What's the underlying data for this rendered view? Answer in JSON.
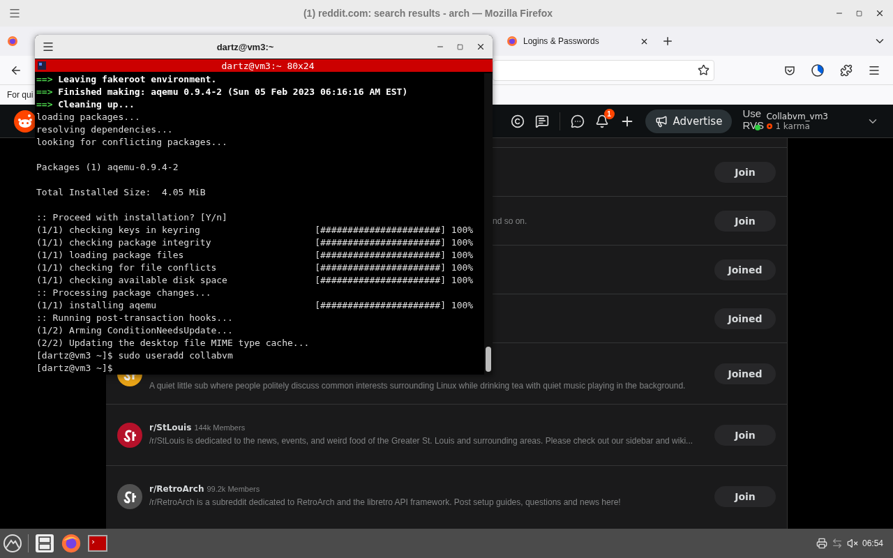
{
  "browser": {
    "title": "(1) reddit.com: search results - arch — Mozilla Firefox",
    "tabs": [
      {
        "label": "Logins & Passwords",
        "selected": false
      }
    ],
    "bookmarks": [
      "For qui"
    ]
  },
  "reddit_header": {
    "notification_count": "1",
    "advertise": "Advertise",
    "avatar_alt": [
      "Use",
      "RVS"
    ],
    "username": "Collabvm_vm3",
    "karma": "1 karma"
  },
  "communities": [
    {
      "kind": "covered",
      "button": "Join"
    },
    {
      "kind": "covered",
      "description": "nd so on.",
      "button": "Join"
    },
    {
      "kind": "covered",
      "button": "Joined"
    },
    {
      "kind": "covered",
      "button": "Joined"
    },
    {
      "kind": "partial",
      "color": "#e8a317",
      "description": "A quiet little sub where people politely discuss common interests surrounding Linux while drinking tea with quiet music playing in the background.",
      "button": "Joined"
    },
    {
      "kind": "full",
      "color": "#b5112a",
      "name": "r/StLouis",
      "members": "144k Members",
      "description": "/r/StLouis is dedicated to the news, events, and weird food of the Greater St. Louis and surrounding areas. Please check out our sidebar and wiki...",
      "button": "Join"
    },
    {
      "kind": "full",
      "color": "#505050",
      "name": "r/RetroArch",
      "members": "99.2k Members",
      "description": "/r/RetroArch is a subreddit dedicated to RetroArch and the libretro API framework. Post setup guides, questions and news here!",
      "button": "Join"
    }
  ],
  "terminal": {
    "title": "dartz@vm3:~",
    "header": "dartz@vm3:~ 80x24",
    "lines": [
      {
        "kind": "arrow",
        "prefix": "==>",
        "text": "Leaving fakeroot environment."
      },
      {
        "kind": "arrow",
        "prefix": "==>",
        "text": "Finished making: aqemu 0.9.4-2 (Sun 05 Feb 2023 06:16:16 AM EST)"
      },
      {
        "kind": "arrow",
        "prefix": "==>",
        "text": "Cleaning up..."
      },
      {
        "kind": "plain",
        "text": "loading packages..."
      },
      {
        "kind": "plain",
        "text": "resolving dependencies..."
      },
      {
        "kind": "plain",
        "text": "looking for conflicting packages..."
      },
      {
        "kind": "blank"
      },
      {
        "kind": "plain",
        "text": "Packages (1) aqemu-0.9.4-2"
      },
      {
        "kind": "blank"
      },
      {
        "kind": "plain",
        "text": "Total Installed Size:  4.05 MiB"
      },
      {
        "kind": "blank"
      },
      {
        "kind": "plain",
        "text": ":: Proceed with installation? [Y/n]"
      },
      {
        "kind": "progress",
        "text": "(1/1) checking keys in keyring",
        "bar": "[######################] 100%"
      },
      {
        "kind": "progress",
        "text": "(1/1) checking package integrity",
        "bar": "[######################] 100%"
      },
      {
        "kind": "progress",
        "text": "(1/1) loading package files",
        "bar": "[######################] 100%"
      },
      {
        "kind": "progress",
        "text": "(1/1) checking for file conflicts",
        "bar": "[######################] 100%"
      },
      {
        "kind": "progress",
        "text": "(1/1) checking available disk space",
        "bar": "[######################] 100%"
      },
      {
        "kind": "plain",
        "text": ":: Processing package changes..."
      },
      {
        "kind": "progress",
        "text": "(1/1) installing aqemu",
        "bar": "[######################] 100%"
      },
      {
        "kind": "plain",
        "text": ":: Running post-transaction hooks..."
      },
      {
        "kind": "plain",
        "text": "(1/2) Arming ConditionNeedsUpdate..."
      },
      {
        "kind": "plain",
        "text": "(2/2) Updating the desktop file MIME type cache..."
      },
      {
        "kind": "plain",
        "text": "[dartz@vm3 ~]$ sudo useradd collabvm"
      },
      {
        "kind": "plain",
        "text": "[dartz@vm3 ~]$"
      }
    ]
  },
  "taskbar": {
    "clock": "06:54"
  }
}
